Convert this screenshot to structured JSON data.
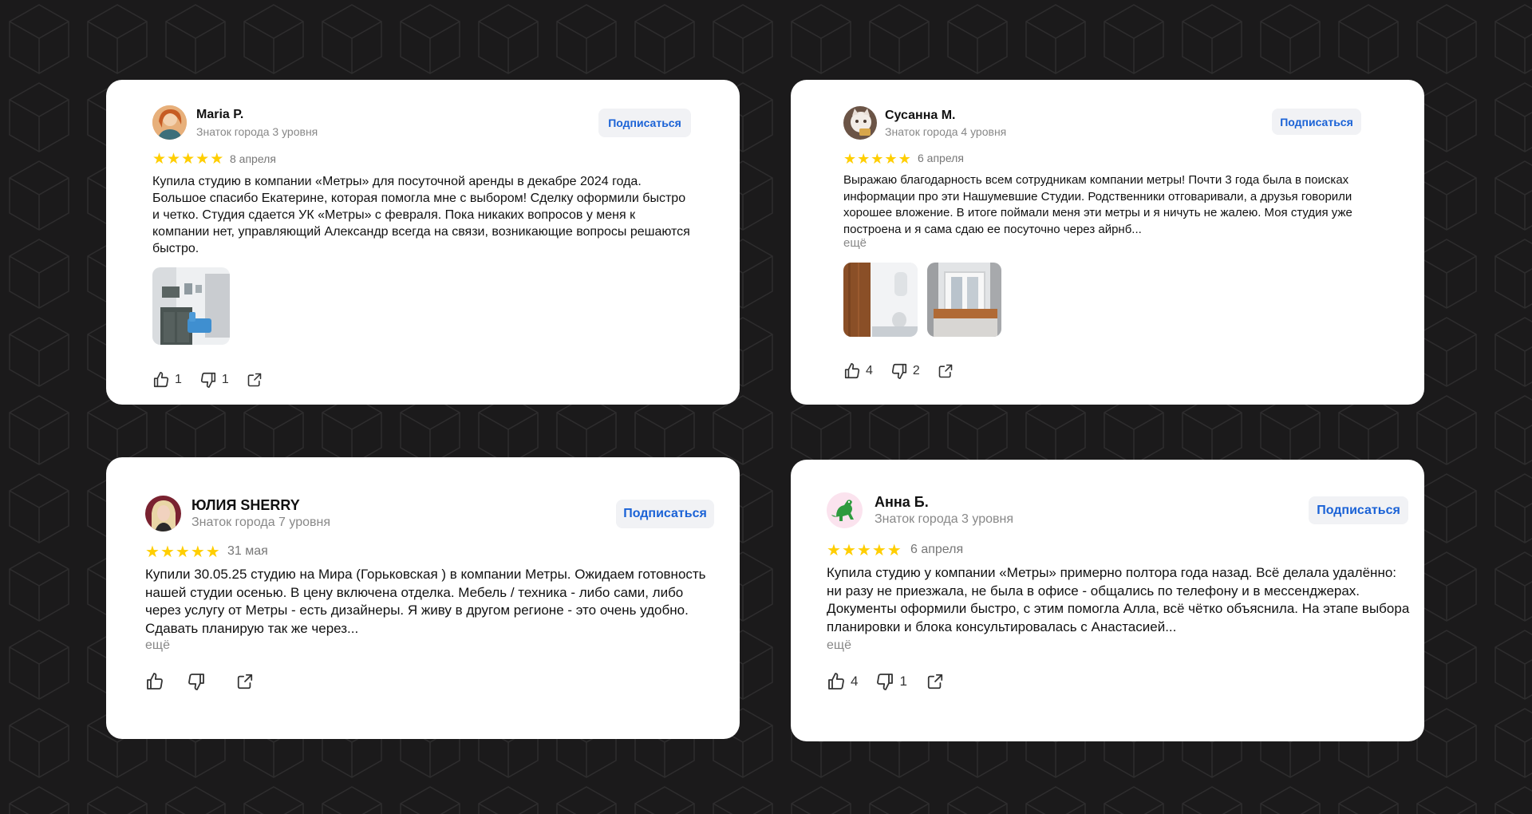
{
  "colors": {
    "background": "#1b1a1b",
    "card": "#ffffff",
    "star": "#ffce00",
    "subscribe_text": "#1a62d6",
    "subscribe_bg": "#f1f2f5"
  },
  "reviews": [
    {
      "author": "Maria P.",
      "level": "Знаток города 3 уровня",
      "subscribe": "Подписаться",
      "rating": 5,
      "date": "8 апреля",
      "text": "Купила студию в компании «Метры» для посуточной аренды в декабре 2024 года. Большое спасибо Екатерине, которая помогла мне с выбором! Сделку оформили быстро и четко. Студия сдается УК «Метры» с февраля. Пока никаких вопросов у меня к компании нет, управляющий Александр всегда на связи, возникающие вопросы решаются быстро.",
      "more": "",
      "photos": [
        "kitchen-studio-photo"
      ],
      "likes": "1",
      "dislikes": "1"
    },
    {
      "author": "Сусанна М.",
      "level": "Знаток города 4 уровня",
      "subscribe": "Подписаться",
      "rating": 5,
      "date": "6 апреля",
      "text": "Выражаю благодарность всем сотрудникам компании метры! Почти 3 года была в поисках информации про эти Нашумевшие Студии. Родственники отговаривали, а друзья говорили хорошее вложение. В итоге поймали меня эти метры и я ничуть не жалею. Моя студия уже построена и я сама сдаю ее посуточно через айрнб...",
      "more": "ещё",
      "photos": [
        "bathroom-photo",
        "window-room-photo"
      ],
      "likes": "4",
      "dislikes": "2"
    },
    {
      "author": "ЮЛИЯ SHERRY",
      "level": "Знаток города 7 уровня",
      "subscribe": "Подписаться",
      "rating": 5,
      "date": "31 мая",
      "text": "Купили 30.05.25 студию на Мира (Горьковская ) в компании Метры. Ожидаем готовность нашей студии осенью. В цену включена отделка. Мебель / техника - либо сами, либо через услугу от Метры - есть дизайнеры. Я живу в другом регионе - это очень удобно. Сдавать планирую так же через...",
      "more": "ещё",
      "photos": [],
      "likes": "",
      "dislikes": ""
    },
    {
      "author": "Анна Б.",
      "level": "Знаток города 3 уровня",
      "subscribe": "Подписаться",
      "rating": 5,
      "date": "6 апреля",
      "text": "Купила студию у компании «Метры» примерно полтора года назад. Всё делала удалённо: ни разу не приезжала, не была в офисе - общались по телефону и в мессенджерах. Документы оформили быстро, с этим помогла Алла, всё чётко объяснила. На этапе выбора планировки и блока консультировалась с Анастасией...",
      "more": "ещё",
      "photos": [],
      "likes": "4",
      "dislikes": "1"
    }
  ]
}
